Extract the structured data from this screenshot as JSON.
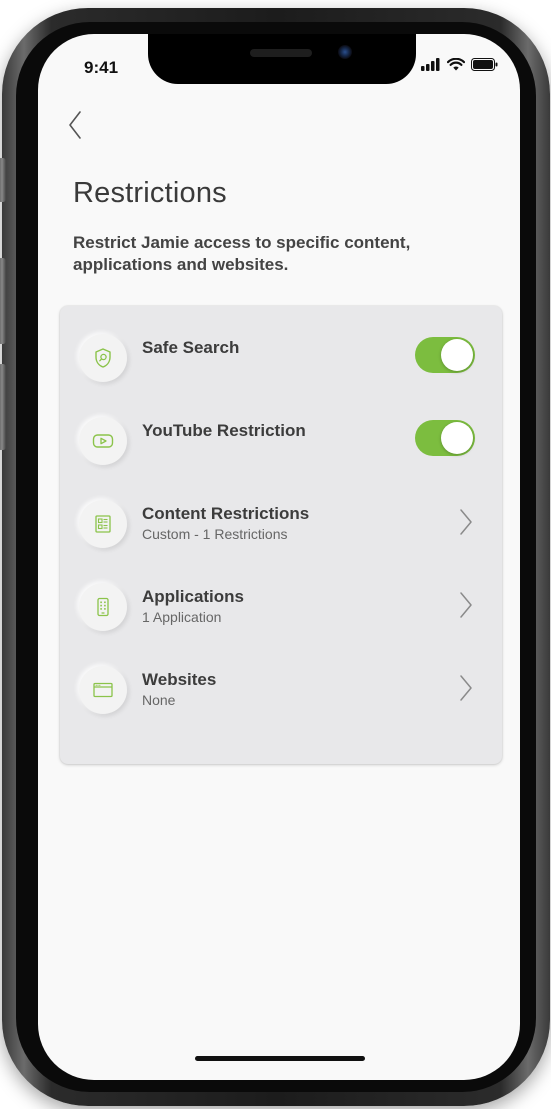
{
  "status_bar": {
    "time": "9:41"
  },
  "header": {
    "back_icon": "chevron-left-icon",
    "title": "Restrictions",
    "description": "Restrict Jamie access to specific content, applications and websites."
  },
  "restrictions": [
    {
      "title": "Safe Search",
      "subtitle": "",
      "icon": "shield-search-icon",
      "control": "toggle",
      "enabled": true
    },
    {
      "title": "YouTube Restriction",
      "subtitle": "",
      "icon": "youtube-play-icon",
      "control": "toggle",
      "enabled": true
    },
    {
      "title": "Content Restrictions",
      "subtitle": "Custom - 1 Restrictions",
      "icon": "content-list-icon",
      "control": "chevron"
    },
    {
      "title": "Applications",
      "subtitle": "1 Application",
      "icon": "phone-app-icon",
      "control": "chevron"
    },
    {
      "title": "Websites",
      "subtitle": "None",
      "icon": "browser-window-icon",
      "control": "chevron"
    }
  ],
  "colors": {
    "accent_green": "#7cbd3f",
    "icon_green": "#8bc34a",
    "card_background": "#e8e8ea",
    "screen_background": "#f9f9f9"
  }
}
